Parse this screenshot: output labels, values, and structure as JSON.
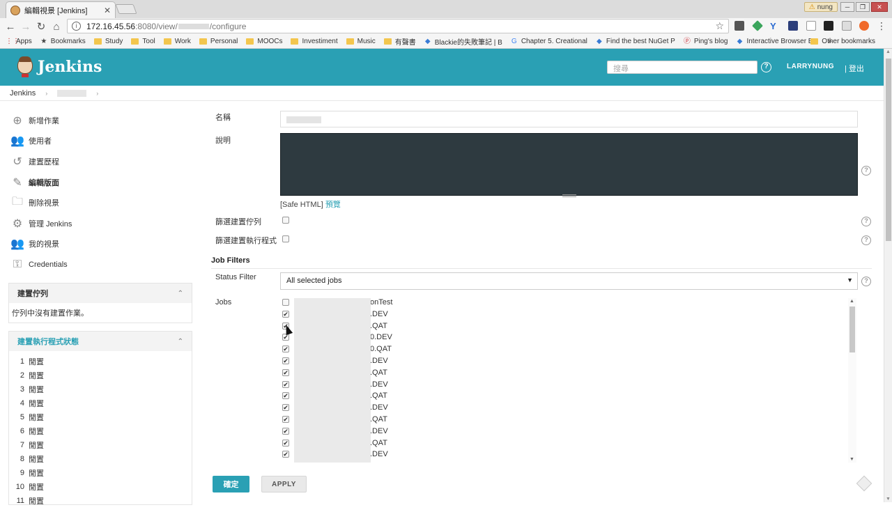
{
  "browser": {
    "tab_title": "編輯視景 [Jenkins]",
    "user_badge": "nung",
    "url_host": "172.16.45.56",
    "url_path_1": ":8080/view/",
    "url_path_2": "/configure",
    "bookmarks": [
      {
        "label": "Apps",
        "icon": "apps-grid-icon"
      },
      {
        "label": "Bookmarks",
        "icon": "star-icon"
      },
      {
        "label": "Study",
        "icon": "folder-icon"
      },
      {
        "label": "Tool",
        "icon": "folder-icon"
      },
      {
        "label": "Work",
        "icon": "folder-icon"
      },
      {
        "label": "Personal",
        "icon": "folder-icon"
      },
      {
        "label": "MOOCs",
        "icon": "folder-icon"
      },
      {
        "label": "Investiment",
        "icon": "folder-icon"
      },
      {
        "label": "Music",
        "icon": "folder-icon"
      },
      {
        "label": "有聲書",
        "icon": "folder-icon"
      },
      {
        "label": "Blackie的失敗筆記 | B",
        "icon": "site-icon"
      },
      {
        "label": "Chapter 5. Creational",
        "icon": "google-icon"
      },
      {
        "label": "Find the best NuGet P",
        "icon": "site-icon"
      },
      {
        "label": "Ping's blog",
        "icon": "pinterest-icon"
      },
      {
        "label": "Interactive Browser Ba",
        "icon": "site-icon"
      }
    ],
    "bookmarks_more": "»",
    "other_bookmarks": "Other bookmarks"
  },
  "header": {
    "logo_text": "Jenkins",
    "search_placeholder": "搜尋",
    "username": "LARRYNUNG",
    "logout": "| 登出"
  },
  "breadcrumb": {
    "root": "Jenkins"
  },
  "sidebar": {
    "tasks": [
      {
        "label": "新增作業",
        "icon": "add-circle-icon"
      },
      {
        "label": "使用者",
        "icon": "users-icon"
      },
      {
        "label": "建置歷程",
        "icon": "history-icon"
      },
      {
        "label": "編輯版面",
        "icon": "pencil-icon"
      },
      {
        "label": "刪除視景",
        "icon": "delete-folder-icon"
      },
      {
        "label": "管理 Jenkins",
        "icon": "gear-icon"
      },
      {
        "label": "我的視景",
        "icon": "users-icon"
      },
      {
        "label": "Credentials",
        "icon": "key-icon"
      }
    ],
    "build_queue": {
      "title": "建置佇列",
      "empty_text": "佇列中沒有建置作業。"
    },
    "executor_status": {
      "title": "建置執行程式狀態",
      "executors": [
        {
          "num": "1",
          "state": "閒置"
        },
        {
          "num": "2",
          "state": "閒置"
        },
        {
          "num": "3",
          "state": "閒置"
        },
        {
          "num": "4",
          "state": "閒置"
        },
        {
          "num": "5",
          "state": "閒置"
        },
        {
          "num": "6",
          "state": "閒置"
        },
        {
          "num": "7",
          "state": "閒置"
        },
        {
          "num": "8",
          "state": "閒置"
        },
        {
          "num": "9",
          "state": "閒置"
        },
        {
          "num": "10",
          "state": "閒置"
        },
        {
          "num": "11",
          "state": "閒置"
        }
      ]
    }
  },
  "form": {
    "name_label": "名稱",
    "description_label": "說明",
    "safe_html": "[Safe HTML]",
    "preview": "預覽",
    "filter_queue_label": "篩選建置佇列",
    "filter_executors_label": "篩選建置執行程式",
    "job_filters_title": "Job Filters",
    "status_filter_label": "Status Filter",
    "status_filter_value": "All selected jobs",
    "jobs_label": "Jobs",
    "jobs": [
      {
        "suffix": "onTest",
        "checked": false
      },
      {
        "suffix": ".DEV",
        "checked": true
      },
      {
        "suffix": ".QAT",
        "checked": true
      },
      {
        "suffix": "0.DEV",
        "checked": true
      },
      {
        "suffix": "0.QAT",
        "checked": true
      },
      {
        "suffix": ".DEV",
        "checked": true
      },
      {
        "suffix": ".QAT",
        "checked": true
      },
      {
        "suffix": ".DEV",
        "checked": true
      },
      {
        "suffix": ".QAT",
        "checked": true
      },
      {
        "suffix": ".DEV",
        "checked": true
      },
      {
        "suffix": ".QAT",
        "checked": true
      },
      {
        "suffix": ".DEV",
        "checked": true
      },
      {
        "suffix": ".QAT",
        "checked": true
      },
      {
        "suffix": ".DEV",
        "checked": true
      }
    ],
    "ok_button": "確定",
    "apply_button": "APPLY"
  },
  "colors": {
    "accent": "#2aa0b4",
    "description_bg": "#2e3a40"
  }
}
